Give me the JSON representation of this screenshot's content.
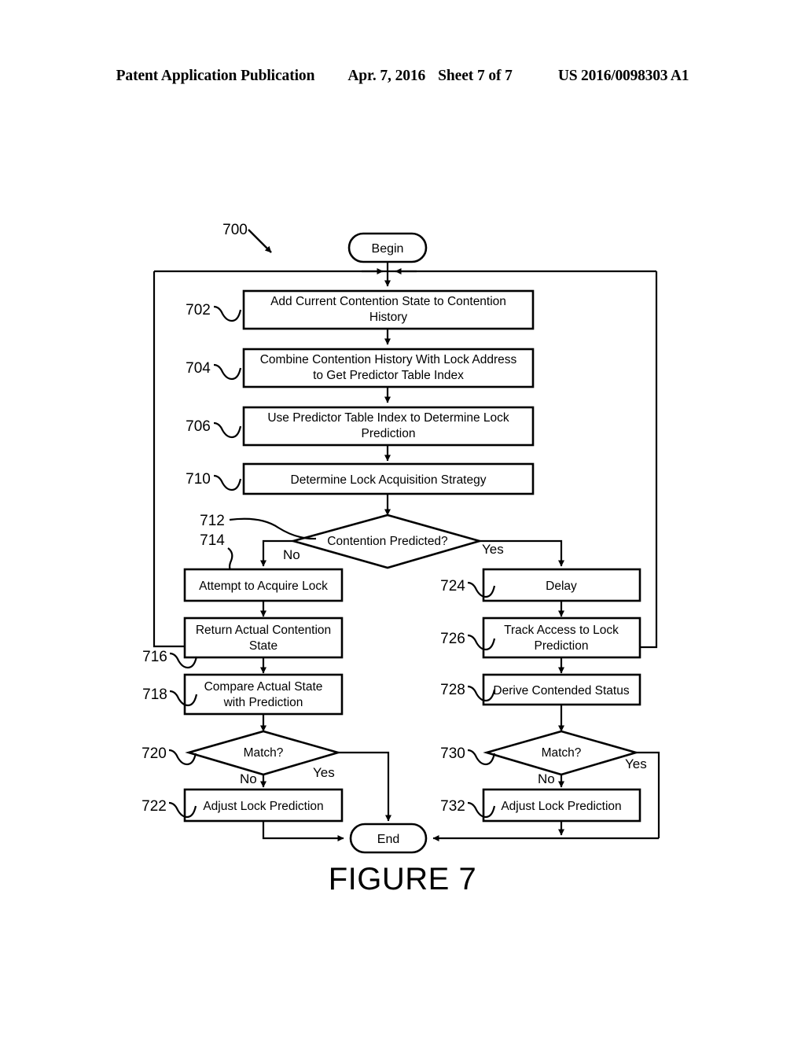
{
  "header": {
    "publication": "Patent Application Publication",
    "date": "Apr. 7, 2016",
    "sheet": "Sheet 7 of 7",
    "patent_number": "US 2016/0098303 A1"
  },
  "figure": {
    "caption": "FIGURE 7",
    "diagram_ref": "700"
  },
  "terminals": {
    "begin": "Begin",
    "end": "End"
  },
  "nodes": {
    "n702": {
      "ref": "702",
      "label": "Add Current Contention State to Contention History",
      "line1": "Add Current Contention State to Contention",
      "line2": "History"
    },
    "n704": {
      "ref": "704",
      "label": "Combine Contention History With Lock Address to Get Predictor Table Index",
      "line1": "Combine Contention History With Lock Address",
      "line2": "to Get Predictor Table Index"
    },
    "n706": {
      "ref": "706",
      "label": "Use Predictor Table Index to Determine Lock Prediction",
      "line1": "Use Predictor Table Index to Determine Lock",
      "line2": "Prediction"
    },
    "n710": {
      "ref": "710",
      "label": "Determine Lock Acquisition Strategy",
      "line1": "Determine Lock Acquisition Strategy",
      "line2": ""
    },
    "n712": {
      "ref": "712",
      "label": "Contention Predicted?"
    },
    "n714": {
      "ref": "714",
      "label": "Attempt to Acquire Lock",
      "line1": "Attempt to Acquire Lock",
      "line2": ""
    },
    "n716": {
      "ref": "716",
      "label": "Return Actual Contention State",
      "line1": "Return Actual Contention",
      "line2": "State"
    },
    "n718": {
      "ref": "718",
      "label": "Compare Actual State with Prediction",
      "line1": "Compare Actual State",
      "line2": "with Prediction"
    },
    "n720": {
      "ref": "720",
      "label": "Match?"
    },
    "n722": {
      "ref": "722",
      "label": "Adjust Lock Prediction",
      "line1": "Adjust Lock Prediction",
      "line2": ""
    },
    "n724": {
      "ref": "724",
      "label": "Delay",
      "line1": "Delay",
      "line2": ""
    },
    "n726": {
      "ref": "726",
      "label": "Track Access to Lock Prediction",
      "line1": "Track Access to Lock",
      "line2": "Prediction"
    },
    "n728": {
      "ref": "728",
      "label": "Derive Contended Status",
      "line1": "Derive Contended Status",
      "line2": ""
    },
    "n730": {
      "ref": "730",
      "label": "Match?"
    },
    "n732": {
      "ref": "732",
      "label": "Adjust Lock Prediction",
      "line1": "Adjust Lock Prediction",
      "line2": ""
    }
  },
  "branches": {
    "d712_no": "No",
    "d712_yes": "Yes",
    "d720_no": "No",
    "d720_yes": "Yes",
    "d730_no": "No",
    "d730_yes": "Yes"
  },
  "colors": {
    "ink": "#000000",
    "paper": "#ffffff"
  }
}
